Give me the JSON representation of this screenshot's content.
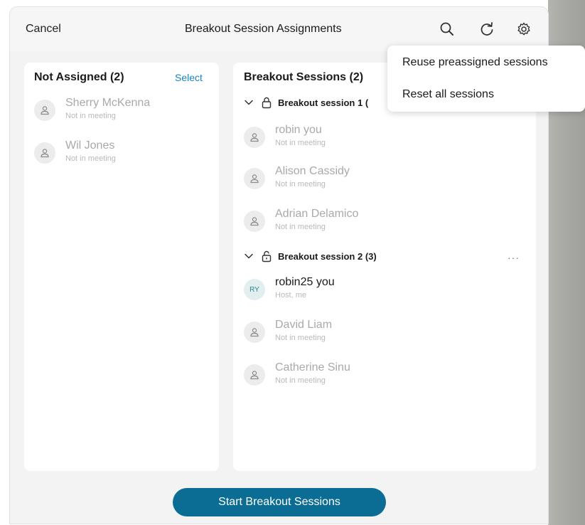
{
  "header": {
    "cancel_label": "Cancel",
    "title": "Breakout Session Assignments",
    "icons": [
      "search-icon",
      "refresh-icon",
      "settings-icon"
    ]
  },
  "not_assigned": {
    "title": "Not Assigned (2)",
    "select_label": "Select",
    "people": [
      {
        "name": "Sherry McKenna",
        "status": "Not in meeting"
      },
      {
        "name": "Wil Jones",
        "status": "Not in meeting"
      }
    ]
  },
  "breakout": {
    "title": "Breakout Sessions (2)",
    "sessions": [
      {
        "label": "Breakout session 1 (",
        "people": [
          {
            "name": "robin you",
            "status": "Not in meeting"
          },
          {
            "name": "Alison Cassidy",
            "status": "Not in meeting"
          },
          {
            "name": "Adrian Delamico",
            "status": "Not in meeting"
          }
        ]
      },
      {
        "label": "Breakout session 2 (3)",
        "more_label": "···",
        "people": [
          {
            "name": "robin25 you",
            "status": "Host, me",
            "initials": "RY"
          },
          {
            "name": "David Liam",
            "status": "Not in meeting"
          },
          {
            "name": "Catherine Sinu",
            "status": "Not in meeting"
          }
        ]
      }
    ]
  },
  "menu": {
    "items": [
      "Reuse preassigned sessions",
      "Reset all sessions"
    ]
  },
  "footer": {
    "start_label": "Start Breakout Sessions"
  },
  "colors": {
    "accent": "#0b6d93",
    "link": "#1a83c4",
    "panel_bg": "#f3f3f4"
  }
}
